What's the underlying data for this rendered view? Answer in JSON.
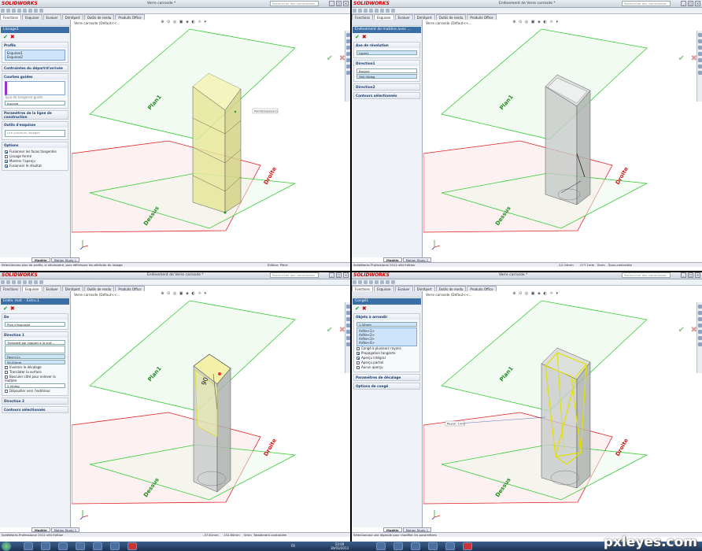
{
  "taskbar": {
    "clock": "23:00",
    "date": "30/03/2013",
    "lang": "FR"
  },
  "watermark": "pxleyes.com",
  "colors": {
    "plane_green": "#33cc33",
    "plane_red": "#dd2222",
    "pm_header": "#3a6ea5",
    "ok": "#1a9a1a",
    "cancel": "#cc0000"
  },
  "quadrants": [
    {
      "app": "SOLIDWORKS",
      "window_title": "Verre carrosde *",
      "search_placeholder": "Rechercher des commandes",
      "tabs": [
        "Fonctions",
        "Esquisse",
        "Evaluer",
        "DimXpert",
        "Outils de rendu",
        "Produits Office"
      ],
      "pm_title": "Lissage1",
      "sections": [
        {
          "title": "Profils",
          "items": [
            "Esquisse1",
            "Esquisse2"
          ]
        },
        {
          "title": "Contraintes du départ/d'arrivée"
        },
        {
          "title": "Courbes guides",
          "fields": [
            "Type de tangence guide",
            "Aucune"
          ]
        },
        {
          "title": "Paramètres de la ligne de construction"
        },
        {
          "title": "Outils d'esquisse",
          "fields": [
            "Lire plusieurs lissages"
          ]
        },
        {
          "title": "Options",
          "checks": [
            {
              "label": "Fusionner les faces tangentes",
              "checked": true
            },
            {
              "label": "Lissage fermé",
              "checked": false
            },
            {
              "label": "Montrer l'aperçu",
              "checked": true
            },
            {
              "label": "Fusionner le résultat",
              "checked": true
            }
          ]
        }
      ],
      "breadcrumb": "Verre carrosde (Défaut<<...",
      "callout": "Point(Esquisse1)",
      "planes": {
        "top": "Plan1",
        "front": "Droite",
        "bottom": "Dessus"
      },
      "bottom_tabs": [
        "Modèle",
        "Motion Study 1"
      ],
      "status": [
        "Sélectionnez plus de profils, si nécessaire, puis définissez les attributs du lissage",
        "Edition: Pièce"
      ]
    },
    {
      "app": "SOLIDWORKS",
      "window_title": "Enlèvement de Verre carrosde *",
      "search_placeholder": "Rechercher des commandes",
      "tabs": [
        "Fonctions",
        "Esquisse",
        "Evaluer",
        "DimXpert",
        "Outils de rendu",
        "Produits Office"
      ],
      "pm_title": "Enlèvement de matière avec ...",
      "sections": [
        {
          "title": "Axe de révolution",
          "fields": [
            "Ligne1"
          ]
        },
        {
          "title": "Direction1",
          "fields": [
            "Borgne",
            "360.00deg"
          ]
        },
        {
          "title": "Direction2"
        },
        {
          "title": "Contours sélectionnés"
        }
      ],
      "breadcrumb": "Verre carrosde (Défaut<<...",
      "planes": {
        "top": "Plan1",
        "front": "Droite",
        "bottom": "Dessus"
      },
      "bottom_tabs": [
        "Modèle",
        "Motion Study 1"
      ],
      "status": [
        "SolidWorks Professional 2012 x64 Edition",
        "-12.24mm",
        "277.1mm",
        "0mm",
        "Sous-contrainte"
      ]
    },
    {
      "app": "SOLIDWORKS",
      "window_title": "Enlèvement de Verre carrosde *",
      "search_placeholder": "Rechercher des commandes",
      "tabs": [
        "Fonctions",
        "Esquisse",
        "Evaluer",
        "DimXpert",
        "Outils de rendu",
        "Produits Office"
      ],
      "pm_title": "Enlèv. mat. - Extru.1",
      "sections": [
        {
          "title": "De",
          "fields": [
            "Plan d'esquisse"
          ]
        },
        {
          "title": "Direction 1",
          "fields": [
            "Translaté par rapport à la surf...",
            "Face<1>",
            "90.00mm"
          ],
          "checks": [
            {
              "label": "Inverser le décalage",
              "checked": false
            },
            {
              "label": "Translater la surface",
              "checked": false
            },
            {
              "label": "Basculer côté pour enlever la matière",
              "checked": false
            },
            {
              "label": "Dépouiller vers l'extérieur",
              "checked": false
            }
          ],
          "angle": "5.00deg"
        },
        {
          "title": "Direction 2"
        },
        {
          "title": "Contours sélectionnés"
        }
      ],
      "breadcrumb": "Verre carrosde (Défaut<<...",
      "dimension": "90",
      "planes": {
        "top": "Plan1",
        "front": "Droite",
        "bottom": "Dessus"
      },
      "bottom_tabs": [
        "Modèle",
        "Motion Study 1"
      ],
      "status": [
        "SolidWorks Professional 2012 x64 Edition",
        "-37.81mm",
        "132.80mm",
        "0mm",
        "Totalement contrainte"
      ]
    },
    {
      "app": "SOLIDWORKS",
      "window_title": "Verre carrosde *",
      "search_placeholder": "Rechercher des commandes",
      "tabs": [
        "Fonctions",
        "Esquisse",
        "Evaluer",
        "DimXpert",
        "Outils de rendu",
        "Produits Office"
      ],
      "pm_title": "Congé1",
      "sections": [
        {
          "title": "Objets à arrondir",
          "fields": [
            "1.50mm"
          ],
          "items": [
            "Arête<1>",
            "Arête<2>",
            "Arête<3>",
            "Arête<4>"
          ],
          "checks": [
            {
              "label": "Congé à plusieurs rayons",
              "checked": false
            },
            {
              "label": "Propagation tangente",
              "checked": true
            },
            {
              "label": "Aperçu intégral",
              "checked": true
            },
            {
              "label": "Aperçu partiel",
              "checked": false
            },
            {
              "label": "Aucun aperçu",
              "checked": false
            }
          ]
        },
        {
          "title": "Paramètres de décalage"
        },
        {
          "title": "Options de congé"
        }
      ],
      "breadcrumb": "Verre carrosde (Défaut<<...",
      "callout": "Rayon: 1mm",
      "planes": {
        "top": "Plan1",
        "front": "Droite",
        "bottom": "Dessus"
      },
      "bottom_tabs": [
        "Modèle",
        "Motion Study 1"
      ],
      "status": [
        "Sélectionnez une légende pour modifier les paramètres"
      ]
    }
  ]
}
